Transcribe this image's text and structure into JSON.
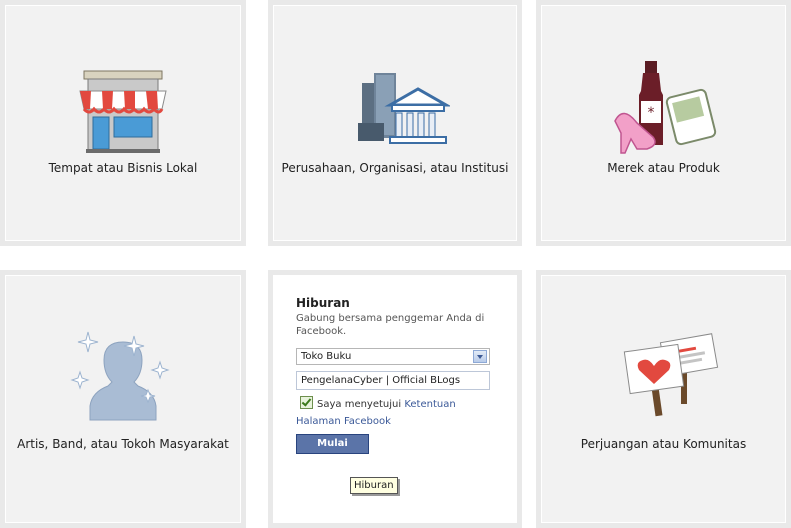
{
  "categories": [
    {
      "label": "Tempat atau Bisnis Lokal",
      "icon": "storefront-icon"
    },
    {
      "label": "Perusahaan, Organisasi, atau Institusi",
      "icon": "buildings-icon"
    },
    {
      "label": "Merek atau Produk",
      "icon": "products-icon"
    },
    {
      "label": "Artis, Band, atau Tokoh Masyarakat",
      "icon": "person-silhouette-icon"
    },
    {
      "label": "Perjuangan atau Komunitas",
      "icon": "protest-signs-icon"
    }
  ],
  "form": {
    "title": "Hiburan",
    "description": "Gabung bersama penggemar Anda di Facebook.",
    "category_select": "Toko Buku",
    "name_value": "PengelanaCyber | Official BLogs",
    "agree_text": "Saya menyetujui",
    "terms_link": "Ketentuan Halaman Facebook",
    "submit_label": "Mulai",
    "tooltip": "Hiburan"
  },
  "colors": {
    "tile_border": "#e9e9e9",
    "tile_bg": "#f2f2f2",
    "link": "#3b5998",
    "button": "#5b74a8"
  }
}
